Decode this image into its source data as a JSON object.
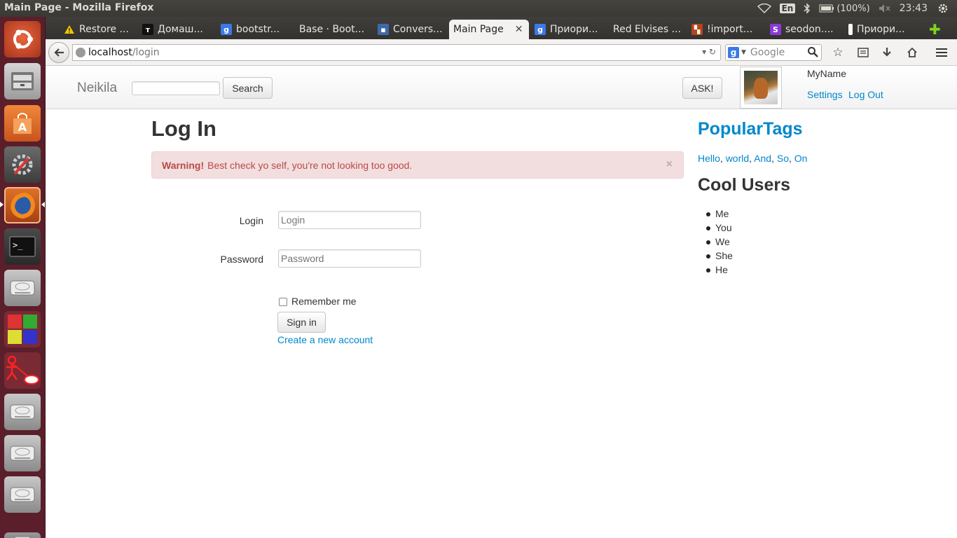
{
  "system": {
    "window_title": "Main Page - Mozilla Firefox",
    "language": "En",
    "battery": "(100%)",
    "clock": "23:43"
  },
  "launcher": {
    "items": [
      "ubuntu-dash-icon",
      "files-icon",
      "software-center-icon",
      "system-settings-icon",
      "firefox-icon",
      "terminal-icon",
      "disk-icon",
      "cube-app-icon",
      "uml-tool-icon",
      "disk-icon",
      "disk-icon",
      "disk-icon",
      "trash-icon"
    ]
  },
  "browser": {
    "tabs": [
      {
        "label": "Restore ...",
        "icon": "warning-icon"
      },
      {
        "label": "Домаш...",
        "icon": "tab-favicon"
      },
      {
        "label": "bootstr...",
        "icon": "google-icon"
      },
      {
        "label": "Base · Boot...",
        "icon": ""
      },
      {
        "label": "Convers...",
        "icon": "chat-icon"
      },
      {
        "label": "Main Page",
        "icon": ""
      },
      {
        "label": "Приори...",
        "icon": "google-icon"
      },
      {
        "label": "Red Elvises ...",
        "icon": ""
      },
      {
        "label": "!import...",
        "icon": "tab-favicon"
      },
      {
        "label": "seodon....",
        "icon": "tab-favicon"
      },
      {
        "label": "Приори...",
        "icon": "tab-favicon"
      }
    ],
    "url_host": "localhost",
    "url_path": "/login",
    "search_placeholder": "Google"
  },
  "site": {
    "brand": "Neikila",
    "search_button": "Search",
    "ask_button": "ASK!",
    "username": "MyName",
    "settings_link": "Settings",
    "logout_link": "Log Out"
  },
  "main": {
    "title": "Log In",
    "alert_strong": "Warning!",
    "alert_text": "Best check yo self, you're not looking too good.",
    "alert_close": "×",
    "login_label": "Login",
    "login_placeholder": "Login",
    "password_label": "Password",
    "password_placeholder": "Password",
    "remember_label": "Remember me",
    "signin_button": "Sign in",
    "create_link": "Create a new account"
  },
  "sidebar": {
    "tags_title": "PopularTags",
    "tags": [
      "Hello",
      "world",
      "And",
      "So",
      "On"
    ],
    "users_title": "Cool Users",
    "users": [
      "Me",
      "You",
      "We",
      "She",
      "He"
    ]
  },
  "colors": {
    "link": "#0088cc",
    "alert_bg": "#f2dede",
    "alert_text": "#b94a48",
    "launcher_bg": "#5a1f2a"
  }
}
